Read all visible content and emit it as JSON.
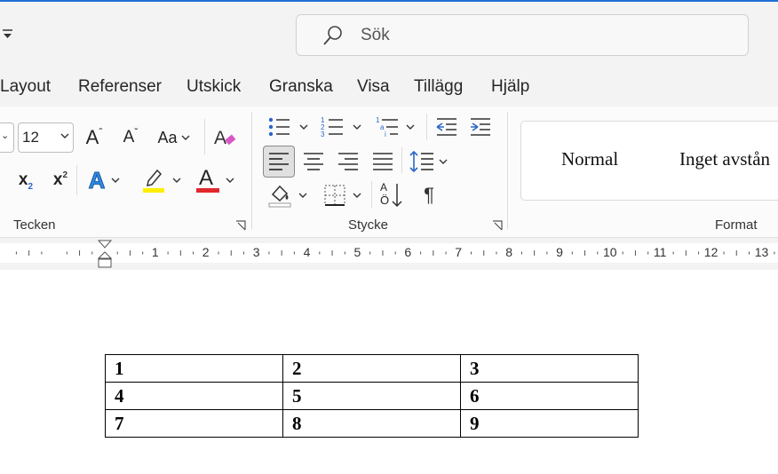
{
  "search": {
    "placeholder": "Sök"
  },
  "menu": {
    "tabs": [
      "Layout",
      "Referenser",
      "Utskick",
      "Granska",
      "Visa",
      "Tillägg",
      "Hjälp"
    ]
  },
  "ribbon": {
    "font": {
      "size_value": "12",
      "grow_font": "A",
      "shrink_font": "A",
      "change_case": "Aa",
      "subscript": "x",
      "subscript_mark": "2",
      "superscript": "x",
      "superscript_mark": "2",
      "text_effects": "A",
      "font_color": "A",
      "highlight_color": "#ffee00",
      "font_color_value": "#e0282e",
      "group_label": "Tecken"
    },
    "paragraph": {
      "sort_glyph_top": "A",
      "sort_glyph_bottom": "Ö",
      "show_marks_glyph": "¶",
      "group_label": "Stycke"
    },
    "styles": {
      "items": [
        "Normal",
        "Inget avstån"
      ],
      "group_label": "Format"
    }
  },
  "ruler": {
    "numbers": [
      "1",
      "2",
      "3",
      "4",
      "5",
      "6",
      "7",
      "8",
      "9",
      "10",
      "11",
      "12",
      "13"
    ]
  },
  "document": {
    "table": [
      [
        "1",
        "2",
        "3"
      ],
      [
        "4",
        "5",
        "6"
      ],
      [
        "7",
        "8",
        "9"
      ]
    ]
  }
}
